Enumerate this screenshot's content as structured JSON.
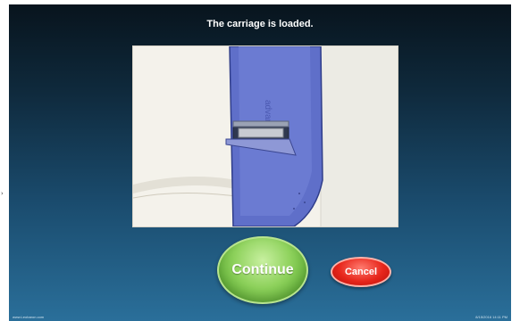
{
  "screen": {
    "title": "The carriage is loaded.",
    "image_icon": "carriage-photo",
    "buttons": {
      "continue_label": "Continue",
      "cancel_label": "Cancel"
    },
    "footer": {
      "website": "www.Leobaron.com",
      "timestamp": "8/15/2016 14:11 PM"
    }
  },
  "colors": {
    "continue": "#7cc84b",
    "cancel": "#e02a1f",
    "background_top": "#08141d",
    "background_bottom": "#2a6f9a"
  }
}
